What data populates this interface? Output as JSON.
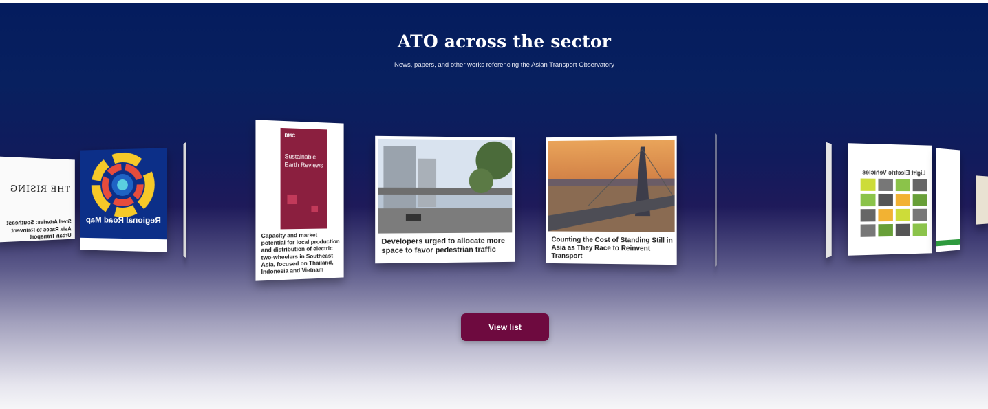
{
  "header": {
    "title": "ATO across the sector",
    "subtitle": "News, papers, and other works referencing the Asian Transport Observatory"
  },
  "cards": {
    "rising": {
      "brand": "THE RISING",
      "title": "Steel Arteries: Southeast Asia Races to Reinvent Urban Transport"
    },
    "roadmap": {
      "title": "Regional Road Map"
    },
    "sustainable": {
      "cover_brand": "BMC",
      "cover_title": "Sustainable Earth Reviews",
      "title": "Capacity and market potential for local production and distribution of electric two-wheelers in Southeast Asia, focused on Thailand, Indonesia and Vietnam"
    },
    "pedestrian": {
      "title": "Developers urged to allocate more space to favor pedestrian traffic"
    },
    "bridge": {
      "title": "Counting the Cost of Standing Still in Asia as They Race to Reinvent Transport"
    },
    "lev": {
      "title": "Light Electric Vehicles"
    }
  },
  "actions": {
    "view_list_label": "View list"
  },
  "colors": {
    "background_top": "#041c5e",
    "button": "#6e0a3f",
    "sustainable_cover": "#8b1f3f"
  }
}
